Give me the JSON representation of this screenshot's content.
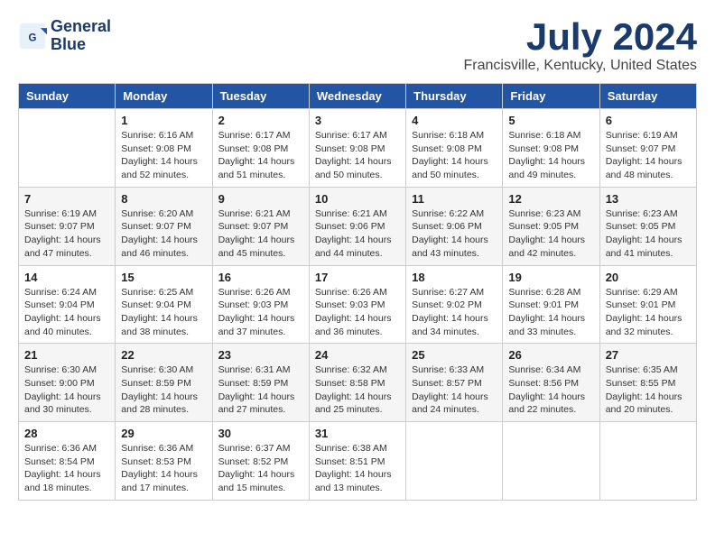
{
  "logo": {
    "line1": "General",
    "line2": "Blue"
  },
  "title": "July 2024",
  "location": "Francisville, Kentucky, United States",
  "days_header": [
    "Sunday",
    "Monday",
    "Tuesday",
    "Wednesday",
    "Thursday",
    "Friday",
    "Saturday"
  ],
  "weeks": [
    [
      {
        "day": "",
        "info": ""
      },
      {
        "day": "1",
        "info": "Sunrise: 6:16 AM\nSunset: 9:08 PM\nDaylight: 14 hours\nand 52 minutes."
      },
      {
        "day": "2",
        "info": "Sunrise: 6:17 AM\nSunset: 9:08 PM\nDaylight: 14 hours\nand 51 minutes."
      },
      {
        "day": "3",
        "info": "Sunrise: 6:17 AM\nSunset: 9:08 PM\nDaylight: 14 hours\nand 50 minutes."
      },
      {
        "day": "4",
        "info": "Sunrise: 6:18 AM\nSunset: 9:08 PM\nDaylight: 14 hours\nand 50 minutes."
      },
      {
        "day": "5",
        "info": "Sunrise: 6:18 AM\nSunset: 9:08 PM\nDaylight: 14 hours\nand 49 minutes."
      },
      {
        "day": "6",
        "info": "Sunrise: 6:19 AM\nSunset: 9:07 PM\nDaylight: 14 hours\nand 48 minutes."
      }
    ],
    [
      {
        "day": "7",
        "info": "Sunrise: 6:19 AM\nSunset: 9:07 PM\nDaylight: 14 hours\nand 47 minutes."
      },
      {
        "day": "8",
        "info": "Sunrise: 6:20 AM\nSunset: 9:07 PM\nDaylight: 14 hours\nand 46 minutes."
      },
      {
        "day": "9",
        "info": "Sunrise: 6:21 AM\nSunset: 9:07 PM\nDaylight: 14 hours\nand 45 minutes."
      },
      {
        "day": "10",
        "info": "Sunrise: 6:21 AM\nSunset: 9:06 PM\nDaylight: 14 hours\nand 44 minutes."
      },
      {
        "day": "11",
        "info": "Sunrise: 6:22 AM\nSunset: 9:06 PM\nDaylight: 14 hours\nand 43 minutes."
      },
      {
        "day": "12",
        "info": "Sunrise: 6:23 AM\nSunset: 9:05 PM\nDaylight: 14 hours\nand 42 minutes."
      },
      {
        "day": "13",
        "info": "Sunrise: 6:23 AM\nSunset: 9:05 PM\nDaylight: 14 hours\nand 41 minutes."
      }
    ],
    [
      {
        "day": "14",
        "info": "Sunrise: 6:24 AM\nSunset: 9:04 PM\nDaylight: 14 hours\nand 40 minutes."
      },
      {
        "day": "15",
        "info": "Sunrise: 6:25 AM\nSunset: 9:04 PM\nDaylight: 14 hours\nand 38 minutes."
      },
      {
        "day": "16",
        "info": "Sunrise: 6:26 AM\nSunset: 9:03 PM\nDaylight: 14 hours\nand 37 minutes."
      },
      {
        "day": "17",
        "info": "Sunrise: 6:26 AM\nSunset: 9:03 PM\nDaylight: 14 hours\nand 36 minutes."
      },
      {
        "day": "18",
        "info": "Sunrise: 6:27 AM\nSunset: 9:02 PM\nDaylight: 14 hours\nand 34 minutes."
      },
      {
        "day": "19",
        "info": "Sunrise: 6:28 AM\nSunset: 9:01 PM\nDaylight: 14 hours\nand 33 minutes."
      },
      {
        "day": "20",
        "info": "Sunrise: 6:29 AM\nSunset: 9:01 PM\nDaylight: 14 hours\nand 32 minutes."
      }
    ],
    [
      {
        "day": "21",
        "info": "Sunrise: 6:30 AM\nSunset: 9:00 PM\nDaylight: 14 hours\nand 30 minutes."
      },
      {
        "day": "22",
        "info": "Sunrise: 6:30 AM\nSunset: 8:59 PM\nDaylight: 14 hours\nand 28 minutes."
      },
      {
        "day": "23",
        "info": "Sunrise: 6:31 AM\nSunset: 8:59 PM\nDaylight: 14 hours\nand 27 minutes."
      },
      {
        "day": "24",
        "info": "Sunrise: 6:32 AM\nSunset: 8:58 PM\nDaylight: 14 hours\nand 25 minutes."
      },
      {
        "day": "25",
        "info": "Sunrise: 6:33 AM\nSunset: 8:57 PM\nDaylight: 14 hours\nand 24 minutes."
      },
      {
        "day": "26",
        "info": "Sunrise: 6:34 AM\nSunset: 8:56 PM\nDaylight: 14 hours\nand 22 minutes."
      },
      {
        "day": "27",
        "info": "Sunrise: 6:35 AM\nSunset: 8:55 PM\nDaylight: 14 hours\nand 20 minutes."
      }
    ],
    [
      {
        "day": "28",
        "info": "Sunrise: 6:36 AM\nSunset: 8:54 PM\nDaylight: 14 hours\nand 18 minutes."
      },
      {
        "day": "29",
        "info": "Sunrise: 6:36 AM\nSunset: 8:53 PM\nDaylight: 14 hours\nand 17 minutes."
      },
      {
        "day": "30",
        "info": "Sunrise: 6:37 AM\nSunset: 8:52 PM\nDaylight: 14 hours\nand 15 minutes."
      },
      {
        "day": "31",
        "info": "Sunrise: 6:38 AM\nSunset: 8:51 PM\nDaylight: 14 hours\nand 13 minutes."
      },
      {
        "day": "",
        "info": ""
      },
      {
        "day": "",
        "info": ""
      },
      {
        "day": "",
        "info": ""
      }
    ]
  ]
}
